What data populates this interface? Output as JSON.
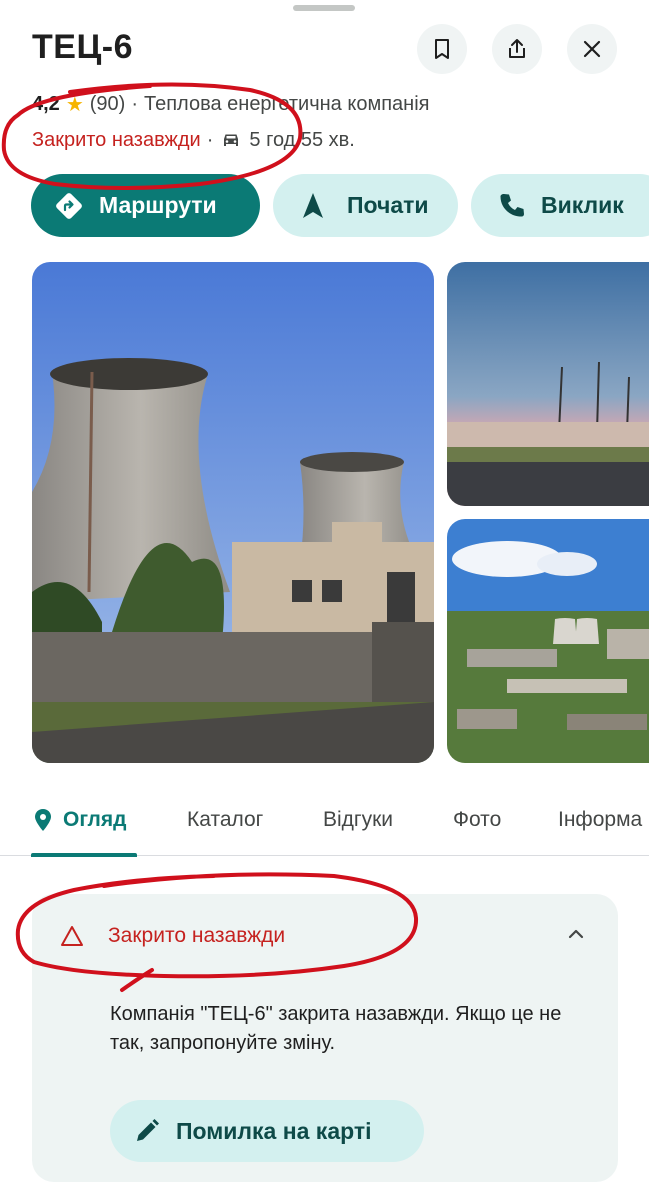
{
  "header": {
    "title": "ТЕЦ-6",
    "save_icon": "bookmark-icon",
    "share_icon": "share-icon",
    "close_icon": "close-icon"
  },
  "place": {
    "rating": "4,2",
    "reviews_count": "(90)",
    "separator": "·",
    "category": "Теплова енергетична компанія",
    "status": "Закрито назавжди",
    "travel_time": "5 год 55 хв.",
    "travel_icon": "car-icon"
  },
  "actions": {
    "directions_label": "Маршрути",
    "start_label": "Почати",
    "call_label": "Виклик"
  },
  "tabs": [
    {
      "label": "Огляд",
      "active": true
    },
    {
      "label": "Каталог",
      "active": false
    },
    {
      "label": "Відгуки",
      "active": false
    },
    {
      "label": "Фото",
      "active": false
    },
    {
      "label": "Інформа",
      "active": false
    }
  ],
  "closed_card": {
    "title": "Закрито назавжди",
    "body": "Компанія \"ТЕЦ-6\" закрита назавжди. Якщо це не так, запропонуйте зміну.",
    "button_label": "Помилка на карті"
  },
  "colors": {
    "accent": "#0b7a75",
    "accent_soft": "#d3f0ef",
    "closed": "#c5221f",
    "annotation": "#d0101c"
  }
}
